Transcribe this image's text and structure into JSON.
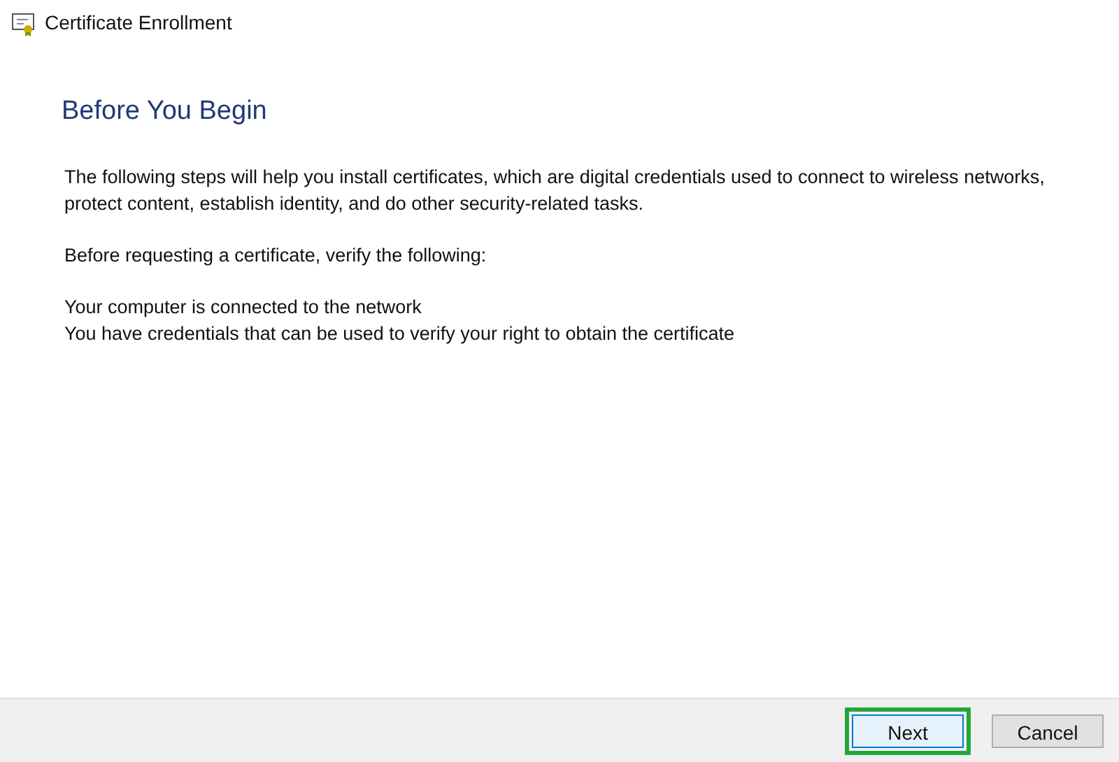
{
  "window": {
    "title": "Certificate Enrollment"
  },
  "heading": "Before You Begin",
  "paragraphs": [
    "The following steps will help you install certificates, which are digital credentials used to connect to wireless networks, protect content, establish identity, and do other security-related tasks.",
    "Before requesting a certificate, verify the following:"
  ],
  "requirements": [
    "Your computer is connected to the network",
    "You have credentials that can be used to verify your right to obtain the certificate"
  ],
  "buttons": [
    {
      "label": "Next",
      "highlighted": true,
      "default": true
    },
    {
      "label": "Cancel",
      "highlighted": false,
      "default": false
    }
  ]
}
